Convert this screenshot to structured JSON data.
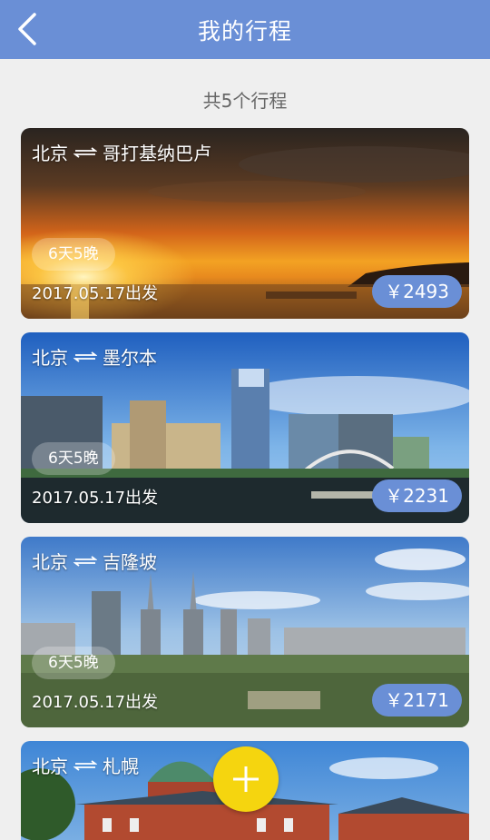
{
  "header": {
    "title": "我的行程",
    "back_icon": "chevron-left-icon"
  },
  "summary": "共5个行程",
  "trips": [
    {
      "route_from": "北京",
      "route_to": "哥打基纳巴卢",
      "duration": "6天5晚",
      "date": "2017.05.17出发",
      "price": "￥2493"
    },
    {
      "route_from": "北京",
      "route_to": "墨尔本",
      "duration": "6天5晚",
      "date": "2017.05.17出发",
      "price": "￥2231"
    },
    {
      "route_from": "北京",
      "route_to": "吉隆坡",
      "duration": "6天5晚",
      "date": "2017.05.17出发",
      "price": "￥2171"
    },
    {
      "route_from": "北京",
      "route_to": "札幌"
    }
  ],
  "fab": {
    "icon": "plus-icon"
  },
  "colors": {
    "header": "#6a8fd6",
    "price_badge": "#6a8fd6",
    "fab": "#f5d50f",
    "background": "#efefef"
  }
}
